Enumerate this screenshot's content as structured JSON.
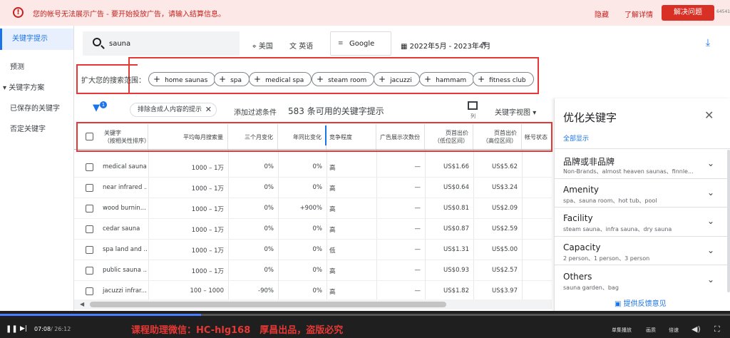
{
  "banner": {
    "message": "您的帐号无法展示广告 - 要开始投放广告，请输入结算信息。",
    "hide_link": "隐藏",
    "learn_link": "了解详情",
    "fix_button": "解决问题",
    "account_id": "64541"
  },
  "leftnav": {
    "items": [
      {
        "label": "关键字提示",
        "active": true
      },
      {
        "label": "预测"
      },
      {
        "label": "▾ 关键字方案"
      },
      {
        "label": "已保存的关键字"
      },
      {
        "label": "否定关键字"
      }
    ]
  },
  "search": {
    "query": "sauna",
    "location": "美国",
    "language": "英语",
    "network": "Google",
    "date_range": "2022年5月 - 2023年4月"
  },
  "broaden": {
    "label": "扩大您的搜索范围：",
    "chips": [
      "home saunas",
      "spa",
      "medical spa",
      "steam room",
      "jacuzzi",
      "hammam",
      "fitness club"
    ]
  },
  "filters": {
    "badge": "1",
    "exclude_chip": "排除含成人内容的提示",
    "add_filter": "添加过滤条件",
    "count_text": "583 条可用的关键字提示",
    "columns_label": "列",
    "view_label": "关键字视图"
  },
  "table": {
    "headers": {
      "keyword_line1": "关键字",
      "keyword_line2": "（按相关性排序）",
      "avg_searches": "平均每月搜索量",
      "three_month": "三个月变化",
      "yoy": "年同比变化",
      "competition": "竞争程度",
      "impression_share": "广告展示次数份",
      "top_bid_low_1": "页首出价",
      "top_bid_low_2": "（低位区间）",
      "top_bid_high_1": "页首出价",
      "top_bid_high_2": "（高位区间）",
      "account_status": "帐号状态"
    },
    "rows": [
      {
        "keyword": "medical sauna",
        "avg": "1000 – 1万",
        "three": "0%",
        "yoy": "0%",
        "comp": "高",
        "share": "—",
        "low": "US$1.66",
        "high": "US$5.62"
      },
      {
        "keyword": "near infrared ...",
        "avg": "1000 – 1万",
        "three": "0%",
        "yoy": "0%",
        "comp": "高",
        "share": "—",
        "low": "US$0.64",
        "high": "US$3.24"
      },
      {
        "keyword": "wood burnin...",
        "avg": "1000 – 1万",
        "three": "0%",
        "yoy": "+900%",
        "comp": "高",
        "share": "—",
        "low": "US$0.81",
        "high": "US$2.09"
      },
      {
        "keyword": "cedar sauna",
        "avg": "1000 – 1万",
        "three": "0%",
        "yoy": "0%",
        "comp": "高",
        "share": "—",
        "low": "US$0.87",
        "high": "US$2.59"
      },
      {
        "keyword": "spa land and ...",
        "avg": "1000 – 1万",
        "three": "0%",
        "yoy": "0%",
        "comp": "低",
        "share": "—",
        "low": "US$1.31",
        "high": "US$5.00"
      },
      {
        "keyword": "public sauna ...",
        "avg": "1000 – 1万",
        "three": "0%",
        "yoy": "0%",
        "comp": "高",
        "share": "—",
        "low": "US$0.93",
        "high": "US$2.57"
      },
      {
        "keyword": "jacuzzi infrar...",
        "avg": "100 – 1000",
        "three": "-90%",
        "yoy": "0%",
        "comp": "高",
        "share": "—",
        "low": "US$1.82",
        "high": "US$3.97"
      }
    ]
  },
  "refine": {
    "title": "优化关键字",
    "show_all": "全部显示",
    "items": [
      {
        "title": "品牌或非品牌",
        "sub": "Non-Brands、almost heaven saunas、finnle..."
      },
      {
        "title": "Amenity",
        "sub": "spa、sauna room、hot tub、pool"
      },
      {
        "title": "Facility",
        "sub": "steam sauna、infra sauna、dry sauna"
      },
      {
        "title": "Capacity",
        "sub": "2 person、1 person、3 person"
      },
      {
        "title": "Others",
        "sub": "sauna garden、bag"
      }
    ],
    "feedback": "提供反馈意见"
  },
  "player": {
    "current": "07:08",
    "duration": "/ 26:12",
    "progress": 0.275,
    "watermark": "课程助理微信：HC-hlg168　厚昌出品，盗版必究",
    "controls": [
      "单集播放",
      "画质",
      "倍速"
    ]
  }
}
